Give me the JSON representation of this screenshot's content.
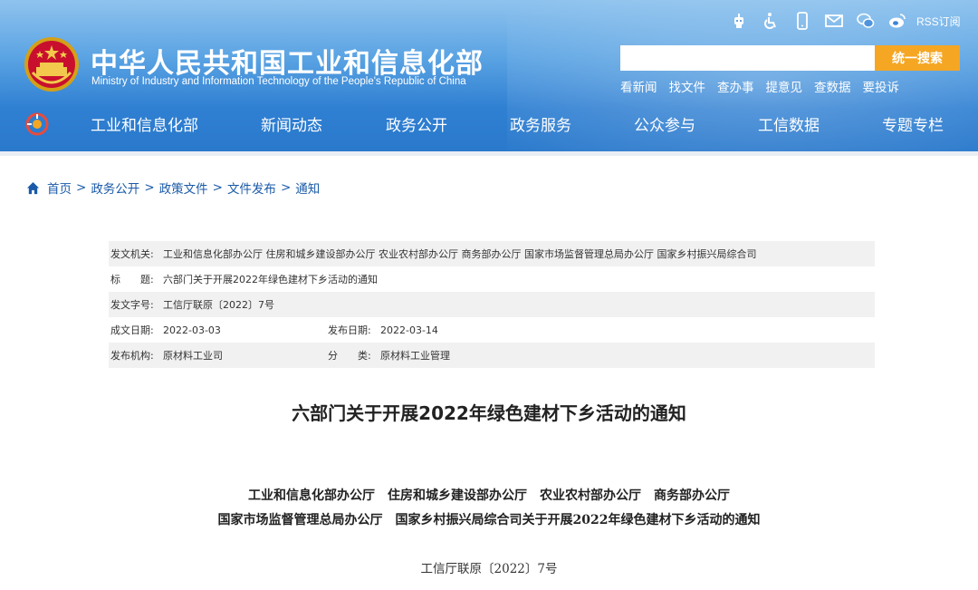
{
  "header": {
    "site_title": "中华人民共和国工业和信息化部",
    "site_subtitle": "Ministry of Industry and Information Technology of the People's Republic of China",
    "top_icons": [
      "robot-icon",
      "accessibility-icon",
      "mobile-icon",
      "mail-icon",
      "wechat-icon",
      "weibo-icon"
    ],
    "rss_label": "RSS订阅",
    "search": {
      "value": "",
      "placeholder": "",
      "button_label": "统一搜索"
    },
    "quick_links": [
      "看新闻",
      "找文件",
      "查办事",
      "提意见",
      "查数据",
      "要投诉"
    ],
    "nav": [
      "工业和信息化部",
      "新闻动态",
      "政务公开",
      "政务服务",
      "公众参与",
      "工信数据",
      "专题专栏"
    ],
    "colors": {
      "header_top": "#8fc3ee",
      "header_bottom": "#2a79cc",
      "search_button": "#f5a623",
      "link": "#1a5aa8"
    }
  },
  "breadcrumb": {
    "items": [
      "首页",
      "政务公开",
      "政策文件",
      "文件发布",
      "通知"
    ],
    "separator": ">"
  },
  "meta": {
    "issuer_label": "发文机关:",
    "issuer_value": "工业和信息化部办公厅 住房和城乡建设部办公厅 农业农村部办公厅 商务部办公厅 国家市场监督管理总局办公厅 国家乡村振兴局综合司",
    "title_label": "标　　题:",
    "title_value": "六部门关于开展2022年绿色建材下乡活动的通知",
    "docno_label": "发文字号:",
    "docno_value": "工信厅联原〔2022〕7号",
    "created_label": "成文日期:",
    "created_value": "2022-03-03",
    "published_label": "发布日期:",
    "published_value": "2022-03-14",
    "org_label": "发布机构:",
    "org_value": "原材料工业司",
    "category_label": "分　　类:",
    "category_value": "原材料工业管理"
  },
  "document": {
    "title": "六部门关于开展2022年绿色建材下乡活动的通知",
    "heading_line1": "工业和信息化部办公厅　住房和城乡建设部办公厅　农业农村部办公厅　商务部办公厅",
    "heading_line2": "国家市场监督管理总局办公厅　国家乡村振兴局综合司关于开展2022年绿色建材下乡活动的通知",
    "doc_number": "工信厅联原〔2022〕7号"
  }
}
